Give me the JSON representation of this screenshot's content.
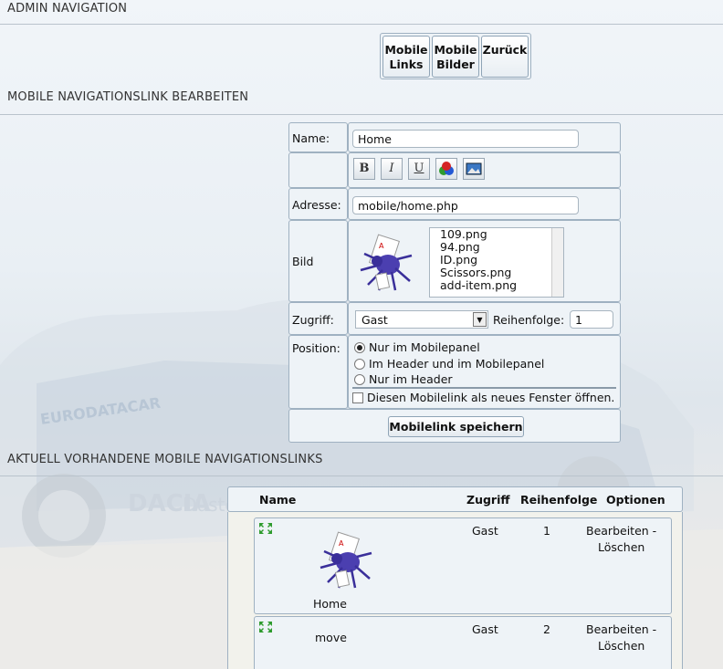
{
  "sections": {
    "admin_nav": "ADMIN NAVIGATION",
    "edit": "MOBILE NAVIGATIONSLINK BEARBEITEN",
    "existing": "AKTUELL VORHANDENE MOBILE NAVIGATIONSLINKS"
  },
  "nav_buttons": {
    "mobile_links_1": "Mobile",
    "mobile_links_2": "Links",
    "mobile_bilder_1": "Mobile",
    "mobile_bilder_2": "Bilder",
    "zurueck": "Zurück"
  },
  "form": {
    "name_label": "Name:",
    "name_value": "Home",
    "toolbar": {
      "bold": "B",
      "italic": "I",
      "underline": "U"
    },
    "address_label": "Adresse:",
    "address_value": "mobile/home.php",
    "image_label": "Bild",
    "image_icon": "spider-card-icon",
    "image_options": [
      "109.png",
      "94.png",
      "ID.png",
      "Scissors.png",
      "add-item.png"
    ],
    "access_label": "Zugriff:",
    "access_value": "Gast",
    "order_label": "Reihenfolge:",
    "order_value": "1",
    "position_label": "Position:",
    "positions": [
      "Nur im Mobilepanel",
      "Im Header und im Mobilepanel",
      "Nur im Header"
    ],
    "position_selected": 0,
    "new_window_label": "Diesen Mobilelink als neues Fenster öffnen.",
    "save_label": "Mobilelink speichern"
  },
  "table": {
    "headers": {
      "name": "Name",
      "access": "Zugriff",
      "order": "Reihenfolge",
      "options": "Optionen"
    },
    "rows": [
      {
        "name": "Home",
        "access": "Gast",
        "order": "1",
        "edit": "Bearbeiten -",
        "delete": "Löschen",
        "icon": "spider-card-icon"
      },
      {
        "name": "move",
        "access": "Gast",
        "order": "2",
        "edit": "Bearbeiten -",
        "delete": "Löschen"
      }
    ]
  },
  "colors": {
    "panel": "#eef3f7",
    "border": "#9fb1c1"
  }
}
